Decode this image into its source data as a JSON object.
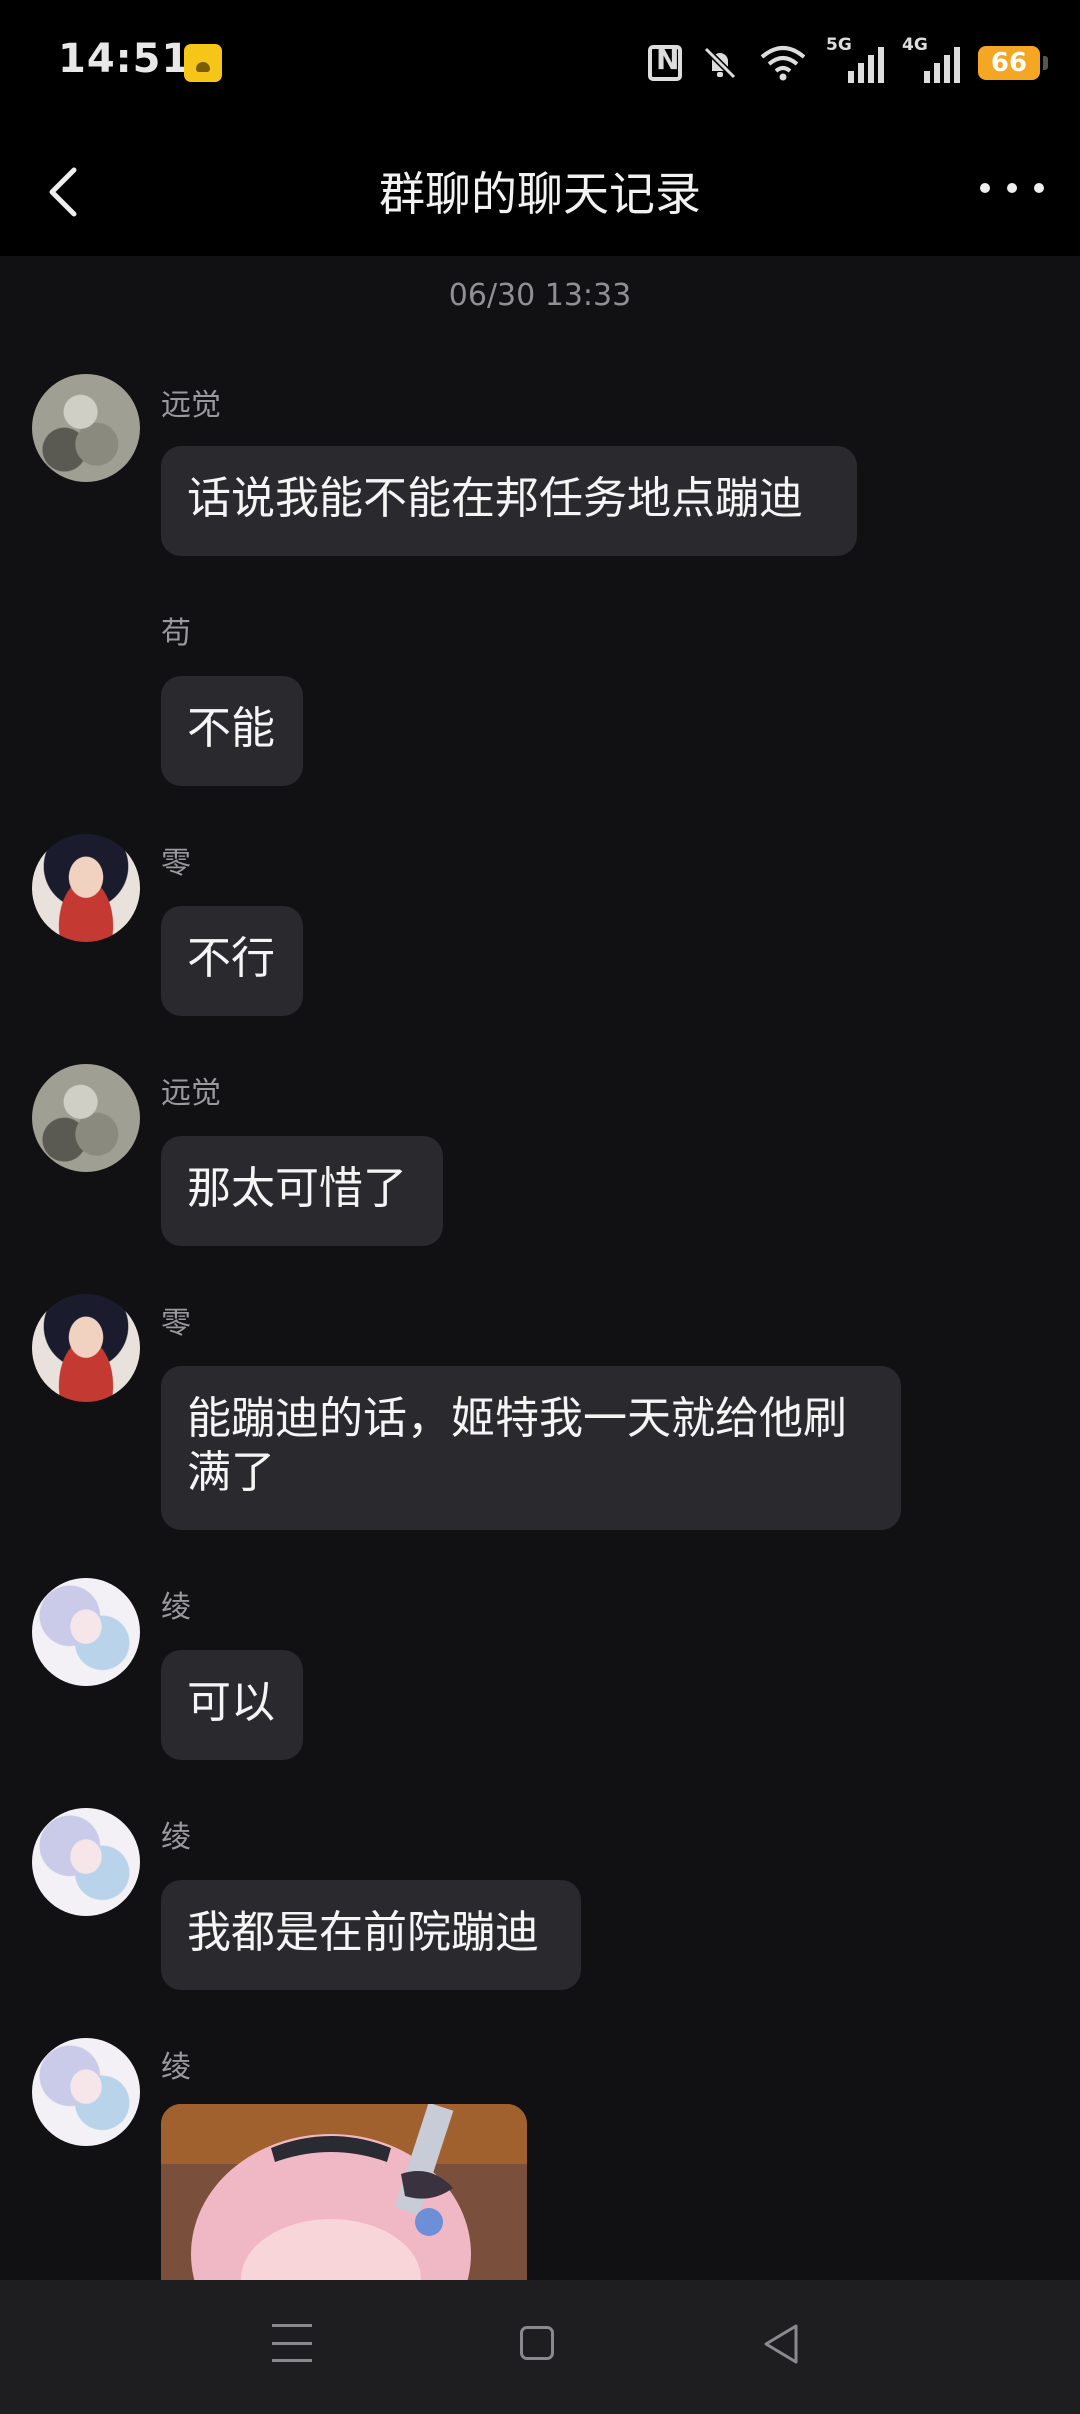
{
  "status_bar": {
    "time": "14:51",
    "battery": "66",
    "signal_1_label": "5G",
    "signal_2_label": "4G"
  },
  "header": {
    "title": "群聊的聊天记录"
  },
  "chat": {
    "timestamp": "06/30 13:33",
    "messages": [
      {
        "sender": "远觉",
        "text": "话说我能不能在邦任务地点蹦迪"
      },
      {
        "sender": "苟",
        "text": "不能"
      },
      {
        "sender": "零",
        "text": "不行"
      },
      {
        "sender": "远觉",
        "text": "那太可惜了"
      },
      {
        "sender": "零",
        "text": "能蹦迪的话，姬特我一天就给他刷满了"
      },
      {
        "sender": "绫",
        "text": "可以"
      },
      {
        "sender": "绫",
        "text": "我都是在前院蹦迪"
      },
      {
        "sender": "绫",
        "text": ""
      }
    ]
  },
  "colors": {
    "background": "#111114",
    "bubble": "#2a2a2e",
    "bar": "#000000",
    "battery": "#f5a623"
  }
}
